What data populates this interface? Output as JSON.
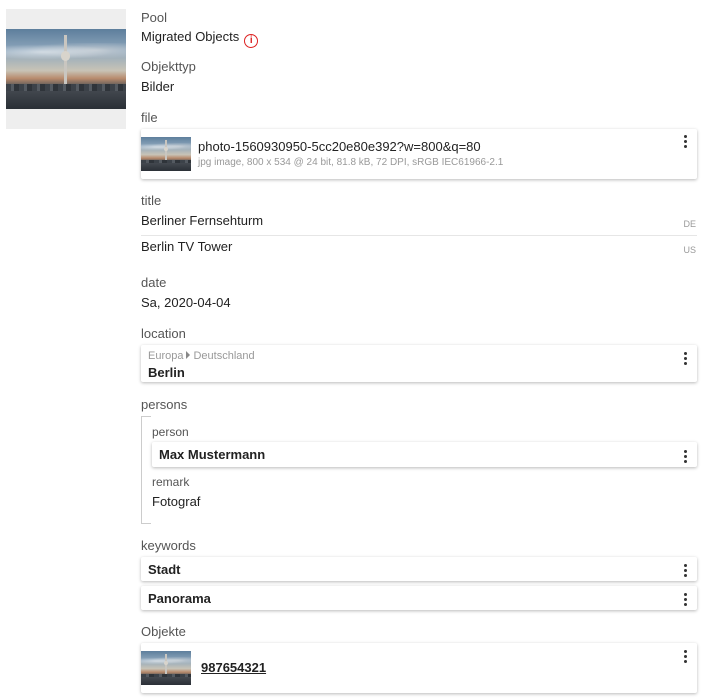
{
  "preview": {
    "image_icon": "berlin-tv-tower-photo"
  },
  "pool": {
    "label": "Pool",
    "value": "Migrated Objects",
    "icon": "info-icon",
    "icon_color": "#dd2222"
  },
  "object_type": {
    "label": "Objekttyp",
    "value": "Bilder"
  },
  "file": {
    "label": "file",
    "name": "photo-1560930950-5cc20e80e392?w=800&q=80",
    "meta": "jpg image,  800 x 534 @ 24 bit,  81.8 kB,  72 DPI,  sRGB IEC61966-2.1"
  },
  "title": {
    "label": "title",
    "entries": [
      {
        "text": "Berliner Fernsehturm",
        "lang": "DE"
      },
      {
        "text": "Berlin TV Tower",
        "lang": "US"
      }
    ]
  },
  "date": {
    "label": "date",
    "value": "Sa, 2020-04-04"
  },
  "location": {
    "label": "location",
    "path": [
      "Europa",
      "Deutschland"
    ],
    "name": "Berlin"
  },
  "persons": {
    "label": "persons",
    "person_label": "person",
    "person": "Max Mustermann",
    "remark_label": "remark",
    "remark": "Fotograf"
  },
  "keywords": {
    "label": "keywords",
    "items": [
      "Stadt",
      "Panorama"
    ]
  },
  "objects": {
    "label": "Objekte",
    "id": "987654321"
  }
}
